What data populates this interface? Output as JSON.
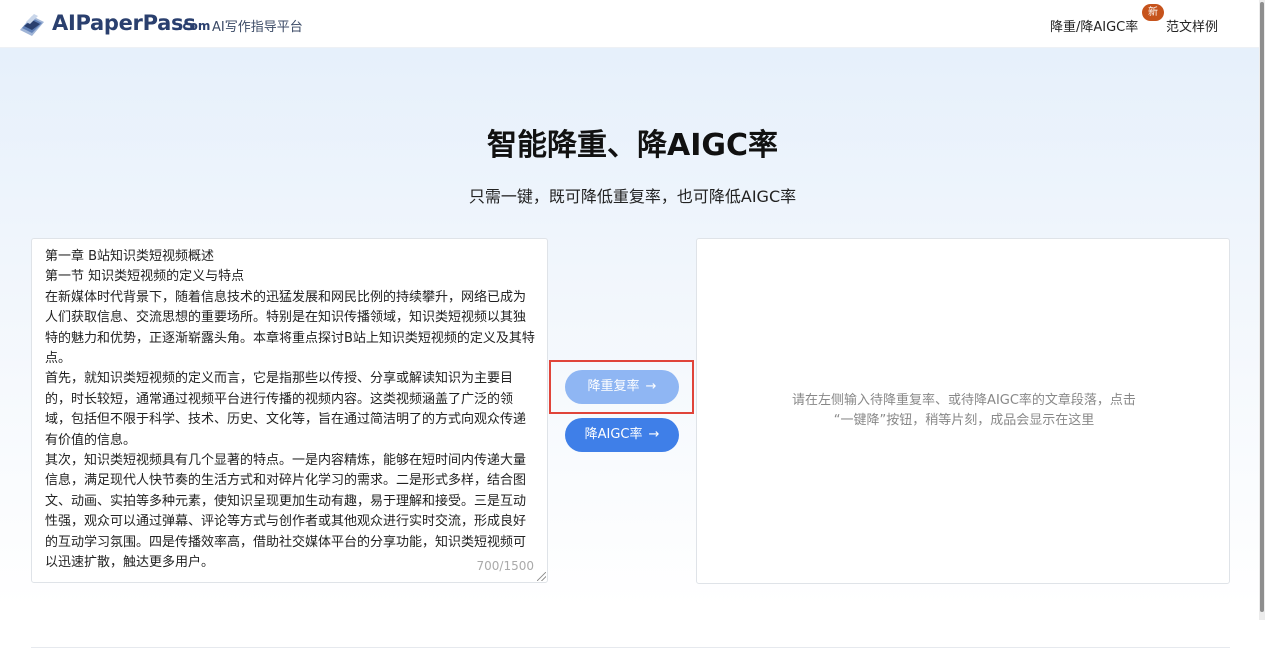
{
  "header": {
    "brand_name": "AIPaperPass",
    "brand_suffix": ".com",
    "tagline": "AI写作指导平台",
    "nav": [
      {
        "label": "降重/降AIGC率",
        "badge": "新"
      },
      {
        "label": "范文样例"
      }
    ]
  },
  "hero": {
    "title": "智能降重、降AIGC率",
    "subtitle": "只需一键，既可降低重复率，也可降低AIGC率"
  },
  "input": {
    "text": "第一章 B站知识类短视频概述\n第一节 知识类短视频的定义与特点\n在新媒体时代背景下，随着信息技术的迅猛发展和网民比例的持续攀升，网络已成为人们获取信息、交流思想的重要场所。特别是在知识传播领域，知识类短视频以其独特的魅力和优势，正逐渐崭露头角。本章将重点探讨B站上知识类短视频的定义及其特点。\n首先，就知识类短视频的定义而言，它是指那些以传授、分享或解读知识为主要目的，时长较短，通常通过视频平台进行传播的视频内容。这类视频涵盖了广泛的领域，包括但不限于科学、技术、历史、文化等，旨在通过简洁明了的方式向观众传递有价值的信息。\n其次，知识类短视频具有几个显著的特点。一是内容精炼，能够在短时间内传递大量信息，满足现代人快节奏的生活方式和对碎片化学习的需求。二是形式多样，结合图文、动画、实拍等多种元素，使知识呈现更加生动有趣，易于理解和接受。三是互动性强，观众可以通过弹幕、评论等方式与创作者或其他观众进行实时交流，形成良好的互动学习氛围。四是传播效率高，借助社交媒体平台的分享功能，知识类短视频可以迅速扩散，触达更多用户。",
    "counter": "700/1500"
  },
  "actions": {
    "reduce_label": "降重复率",
    "aigc_label": "降AIGC率",
    "arrow": "→"
  },
  "output": {
    "placeholder_line1": "请在左侧输入待降重复率、或待降AIGC率的文章段落，点击",
    "placeholder_line2": "“一键降”按钮，稍等片刻，成品会显示在这里"
  },
  "colors": {
    "brand": "#2a3f6e",
    "badge": "#c6531c",
    "button_light": "#8fb6f3",
    "button_primary": "#3f7fe8",
    "highlight": "#e0443a"
  },
  "icons": {
    "logo": "book-stack-logo-icon",
    "resize": "resize-grip-icon"
  }
}
